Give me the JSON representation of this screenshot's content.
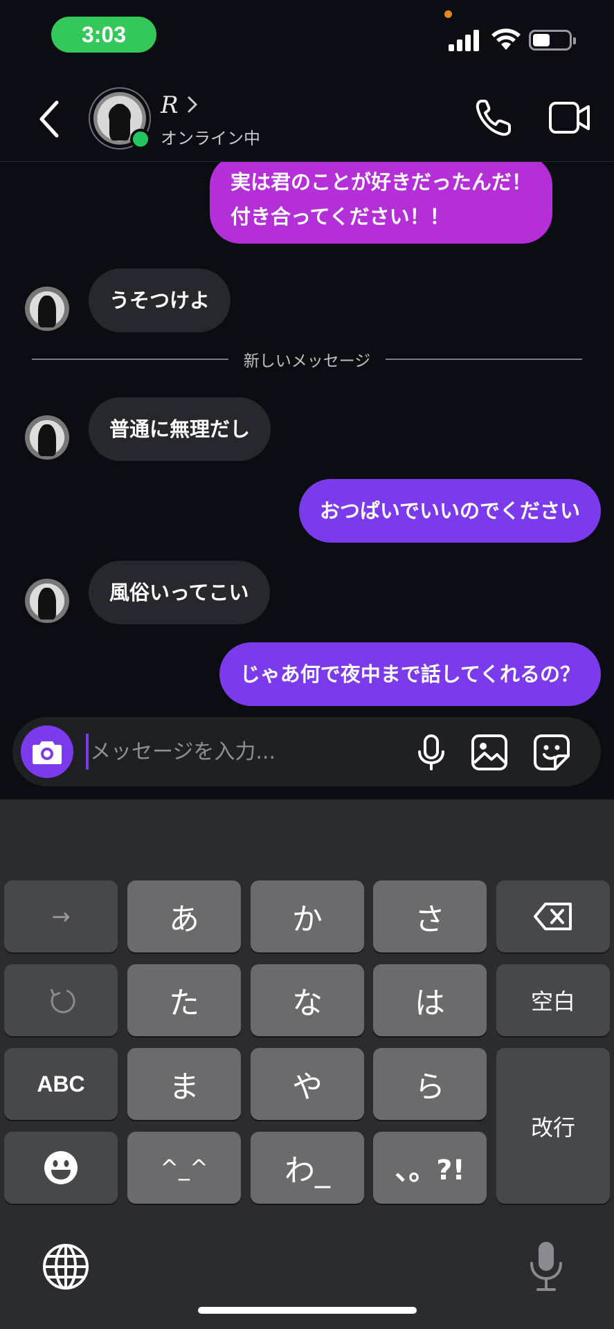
{
  "status_bar": {
    "time": "3:03"
  },
  "header": {
    "contact_name": "R",
    "contact_status": "オンライン中"
  },
  "chat": {
    "messages": [
      {
        "direction": "out",
        "lines": [
          "実は君のことが好きだったんだ！",
          "付き合ってください！！"
        ]
      },
      {
        "direction": "in",
        "text": "うそつけよ"
      },
      {
        "direction": "in",
        "text": "普通に無理だし"
      },
      {
        "direction": "out",
        "text": "おつぱいでいいのでください"
      },
      {
        "direction": "in",
        "text": "風俗いってこい"
      },
      {
        "direction": "out",
        "text": "じゃあ何で夜中まで話してくれるの？"
      }
    ],
    "divider_label": "新しいメッセージ",
    "colors": {
      "outgoing_violet": "#7c3aed",
      "outgoing_magenta": "#b42fd8",
      "incoming": "#26282d"
    }
  },
  "composer": {
    "placeholder": "メッセージを入力...",
    "icons": [
      "camera-icon",
      "microphone-icon",
      "image-icon",
      "sticker-icon"
    ]
  },
  "keyboard": {
    "row1": [
      "→",
      "あ",
      "か",
      "さ",
      "⌫"
    ],
    "row2": [
      "↺",
      "た",
      "な",
      "は",
      "空白"
    ],
    "row3": [
      "ABC",
      "ま",
      "や",
      "ら",
      "改行"
    ],
    "row4": [
      "☺",
      "^_^",
      "わ_",
      "、。?!"
    ],
    "icons": [
      "globe-icon",
      "dictation-mic-icon"
    ]
  }
}
